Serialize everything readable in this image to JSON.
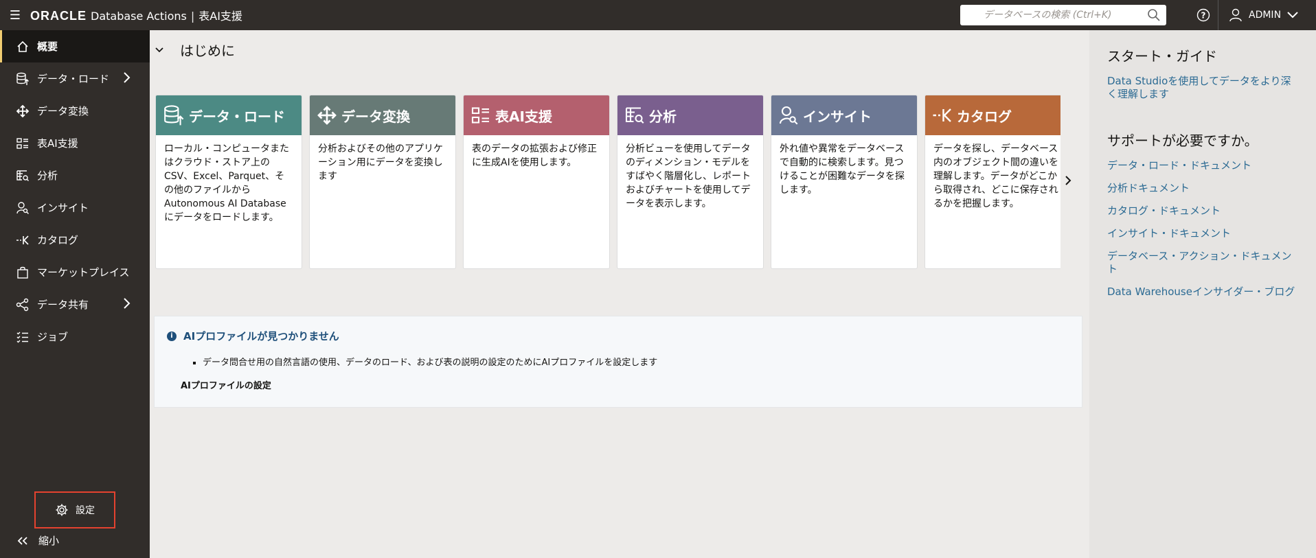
{
  "topbar": {
    "brand_logo": "ORACLE",
    "brand_product": "Database Actions",
    "brand_separator": "|",
    "page_name": "表AI支援",
    "search_placeholder": "データベースの検索 (Ctrl+K)",
    "user_name": "ADMIN"
  },
  "sidebar": {
    "items": [
      {
        "label": "概要",
        "icon": "home-icon"
      },
      {
        "label": "データ・ロード",
        "icon": "database-upload-icon"
      },
      {
        "label": "データ変換",
        "icon": "move-arrows-icon"
      },
      {
        "label": "表AI支援",
        "icon": "table-list-icon"
      },
      {
        "label": "分析",
        "icon": "analytics-table-icon"
      },
      {
        "label": "インサイト",
        "icon": "user-search-icon"
      },
      {
        "label": "カタログ",
        "icon": "catalog-icon"
      },
      {
        "label": "マーケットプレイス",
        "icon": "bag-icon"
      },
      {
        "label": "データ共有",
        "icon": "share-icon"
      },
      {
        "label": "ジョブ",
        "icon": "job-list-icon"
      }
    ],
    "settings_label": "設定",
    "collapse_label": "縮小"
  },
  "main": {
    "section_title": "はじめに",
    "cards": [
      {
        "title": "データ・ロード",
        "color": "#4c8a84",
        "body": "ローカル・コンピュータまたはクラウド・ストア上のCSV、Excel、Parquet、その他のファイルからAutonomous AI Databaseにデータをロードします。"
      },
      {
        "title": "データ変換",
        "color": "#677a76",
        "body": "分析およびその他のアプリケーション用にデータを変換します"
      },
      {
        "title": "表AI支援",
        "color": "#b4606e",
        "body": "表のデータの拡張および修正に生成AIを使用します。"
      },
      {
        "title": "分析",
        "color": "#7a5f8e",
        "body": "分析ビューを使用してデータのディメンション・モデルをすばやく階層化し、レポートおよびチャートを使用してデータを表示します。"
      },
      {
        "title": "インサイト",
        "color": "#6c7894",
        "body": "外れ値や異常をデータベースで自動的に検索します。見つけることが困難なデータを探します。"
      },
      {
        "title": "カタログ",
        "color": "#b8693a",
        "body": "データを探し、データベース内のオブジェクト間の違いを理解します。データがどこから取得され、どこに保存されるかを把握します。"
      }
    ],
    "notice": {
      "title": "AIプロファイルが見つかりません",
      "bullet": "データ問合せ用の自然言語の使用、データのロード、および表の説明の設定のためにAIプロファイルを設定します",
      "link": "AIプロファイルの設定"
    }
  },
  "right_panel": {
    "guide_title": "スタート・ガイド",
    "guide_link": "Data Studioを使用してデータをより深く理解します",
    "support_title": "サポートが必要ですか。",
    "support_links": [
      "データ・ロード・ドキュメント",
      "分析ドキュメント",
      "カタログ・ドキュメント",
      "インサイト・ドキュメント",
      "データベース・アクション・ドキュメント",
      "Data Warehouseインサイダー・ブログ"
    ]
  }
}
